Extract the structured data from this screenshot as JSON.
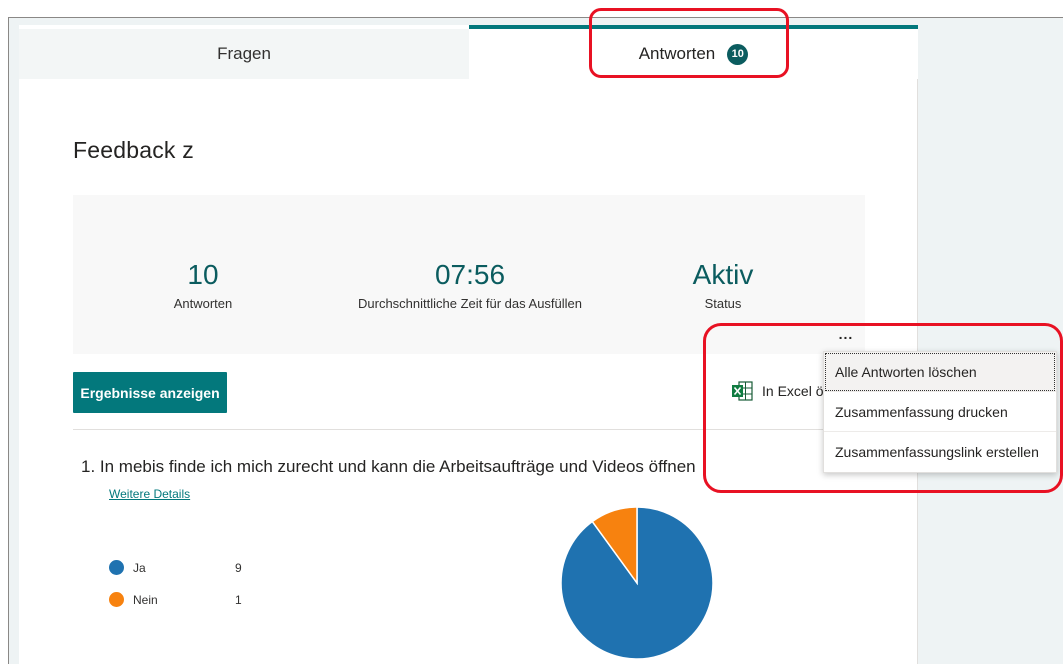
{
  "tabs": {
    "questions_label": "Fragen",
    "responses_label": "Antworten",
    "responses_count": "10"
  },
  "form": {
    "title": "Feedback z"
  },
  "stats": [
    {
      "value": "10",
      "label": "Antworten"
    },
    {
      "value": "07:56",
      "label": "Durchschnittliche Zeit für das Ausfüllen"
    },
    {
      "value": "Aktiv",
      "label": "Status"
    }
  ],
  "toolbar": {
    "more_label": "...",
    "results_label": "Ergebnisse anzeigen",
    "excel_label": "In Excel ö"
  },
  "menu": {
    "items": [
      {
        "label": "Alle Antworten löschen"
      },
      {
        "label": "Zusammenfassung drucken"
      },
      {
        "label": "Zusammenfassungslink erstellen"
      }
    ]
  },
  "question": {
    "title": "1.  In mebis finde ich mich zurecht und kann die Arbeitsaufträge und Videos öffnen",
    "details_link": "Weitere Details"
  },
  "chart_data": {
    "type": "pie",
    "categories": [
      "Ja",
      "Nein"
    ],
    "values": [
      9,
      1
    ],
    "colors": [
      "#1f72b0",
      "#f7820f"
    ]
  },
  "colors": {
    "accent": "#03787c",
    "badge": "#0b5c5f",
    "highlight": "#e81123"
  }
}
